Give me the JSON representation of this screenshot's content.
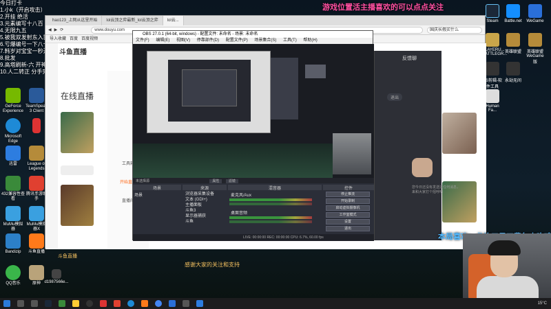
{
  "marquee": "游戏位置活主播喜欢的可以点点关注",
  "chat_overlay": [
    "今日打卡",
    "1.小k（开启攻击）",
    "2.开挂 绝活",
    "3.元素编写十八百",
    "4.无限九五",
    "5.被我双发射东入我手摸索一手",
    "6.亏爆编号一下八十月特",
    "7.韩岁对宝宝一秒开号 我们ID",
    "8.批发",
    "9.高塔刷新-六 开神的活动",
    "10.人二转正 分手完成 ID"
  ],
  "desktop_left": [
    {
      "label": "GeForce Experience",
      "color": "#76b900"
    },
    {
      "label": "TeamSpeak 3 Client",
      "color": "#2a5a9a"
    },
    {
      "label": "Microsoft Edge",
      "color": "#1e8ad6"
    },
    {
      "label": "",
      "color": "#d33"
    },
    {
      "label": "迅雷",
      "color": "#2d7de0"
    },
    {
      "label": "League of Legends",
      "color": "#b58b3a"
    },
    {
      "label": "432兼容性查看",
      "color": "#3a8a3a"
    },
    {
      "label": "腾讯手游助手",
      "color": "#e04030"
    },
    {
      "label": "MuMu模拟器",
      "color": "#3aa0e0"
    },
    {
      "label": "MuMu模拟器X",
      "color": "#3aa0e0"
    },
    {
      "label": "Bandizip",
      "color": "#2c80c8"
    },
    {
      "label": "斗鱼直播",
      "color": "#ff7a1a"
    },
    {
      "label": "QQ音乐",
      "color": "#3ab54a"
    },
    {
      "label": "原神",
      "color": "#b9a37a"
    },
    {
      "label": "d1987566e...",
      "color": "#444"
    }
  ],
  "desktop_right": [
    {
      "label": "Steam",
      "color": "#1b2838"
    },
    {
      "label": "Battle.net",
      "color": "#148eff"
    },
    {
      "label": "WeGame",
      "color": "#2a6fd8"
    },
    {
      "label": "PLAYERU... BATTLEGR...",
      "color": "#c9a54a"
    },
    {
      "label": "英雄联盟",
      "color": "#b58b3a"
    },
    {
      "label": "英雄联盟WeGame版",
      "color": "#b58b3a"
    },
    {
      "label": "PS剪辑-软件工具",
      "color": "#333"
    },
    {
      "label": "永劫无间",
      "color": "#333"
    },
    {
      "label": "Human Fa...",
      "color": "#ddd"
    }
  ],
  "browser": {
    "tabs": [
      "hao123_上网从这里开始",
      "lol云顶之弈最新_lol云顶之弈",
      "lol云..."
    ],
    "url": "www.douyu.com",
    "search_placeholder": "国庆长假买什么",
    "bookmarks": [
      "导入收藏",
      "百度",
      "百度视频"
    ],
    "site_title": "在线直播",
    "logo": "斗鱼直播",
    "nav_items": [
      "工具箱",
      "开始直播",
      "直播间"
    ]
  },
  "obs": {
    "title": "OBS 27.0.1 (64-bit, windows) - 配置文件: 未命名 - 场景: 未命名",
    "menu": [
      "文件(F)",
      "编辑(E)",
      "视图(V)",
      "停靠部件(D)",
      "配置文件(P)",
      "场景集合(S)",
      "工具(T)",
      "帮助(H)"
    ],
    "no_source": "未选择源",
    "properties_button": "属性",
    "filters_button": "滤镜",
    "docks": {
      "scenes": "场景",
      "sources": "来源",
      "mixer": "混音器",
      "controls": "控件"
    },
    "scene_items": [
      "场景"
    ],
    "source_items": [
      "浏览器采集设备",
      "文本 (GDI+)",
      "主播面板",
      "斗鱼3",
      "显示器捕获",
      "斗鱼"
    ],
    "mixer_items": [
      "麦克风/Aux",
      "桌面音频"
    ],
    "controls": [
      "停止推流",
      "开始录制",
      "启动虚拟摄像机",
      "工作室模式",
      "设置",
      "退出"
    ],
    "status": "LIVE: 00:00:00   REC: 00:00:00   CPU: 6.7%, 60.00 fps"
  },
  "chat_panel": {
    "title": "反馈聊",
    "button": "退出",
    "empty_text": "您今日还没有发送过任何消息，来和大家打个招呼吧"
  },
  "bottom_banner": "本局喜欢：龙族三星五费包爽吃鸡",
  "bottom_caption": "感谢大家的关注和支持",
  "small_caption": "斗鱼直播",
  "taskbar": {
    "temp": "15°C"
  }
}
